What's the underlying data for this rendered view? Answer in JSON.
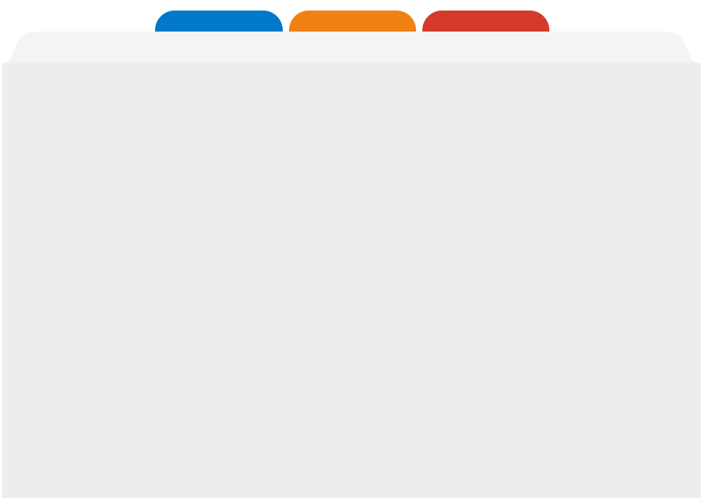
{
  "tabs": [
    {
      "color": "#0079c9"
    },
    {
      "color": "#f08113"
    },
    {
      "color": "#d43b2b"
    }
  ],
  "folder": {
    "tab_strip_color": "#f4f4f4",
    "body_color": "#ededed",
    "divider_color": "#b8b8b8"
  }
}
